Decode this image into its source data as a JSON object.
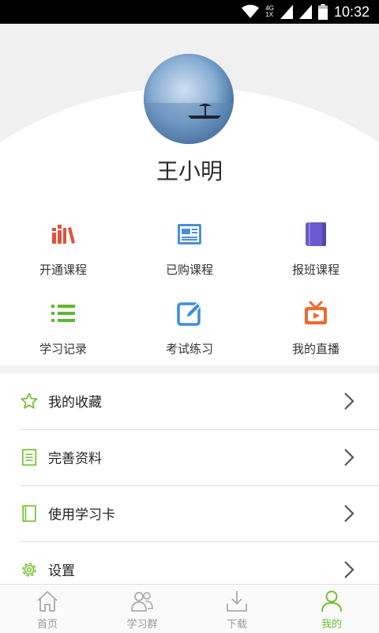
{
  "status_bar": {
    "time": "10:32",
    "net_top": "4G",
    "net_bottom": "1X"
  },
  "profile": {
    "username": "王小明"
  },
  "grid": [
    {
      "label": "开通课程",
      "icon": "books-icon",
      "color": "#e0533b"
    },
    {
      "label": "已购课程",
      "icon": "newspaper-icon",
      "color": "#4a90d9"
    },
    {
      "label": "报班课程",
      "icon": "notebook-icon",
      "color": "#6a5acd"
    },
    {
      "label": "学习记录",
      "icon": "list-icon",
      "color": "#5fb832"
    },
    {
      "label": "考试练习",
      "icon": "edit-icon",
      "color": "#3b8ee0"
    },
    {
      "label": "我的直播",
      "icon": "tv-icon",
      "color": "#f0692c"
    }
  ],
  "menu": [
    {
      "label": "我的收藏",
      "icon": "star-icon"
    },
    {
      "label": "完善资料",
      "icon": "document-icon"
    },
    {
      "label": "使用学习卡",
      "icon": "card-icon"
    },
    {
      "label": "设置",
      "icon": "gear-icon"
    }
  ],
  "tabs": [
    {
      "label": "首页",
      "icon": "home-icon",
      "active": false
    },
    {
      "label": "学习群",
      "icon": "group-icon",
      "active": false
    },
    {
      "label": "下载",
      "icon": "download-icon",
      "active": false
    },
    {
      "label": "我的",
      "icon": "person-icon",
      "active": true
    }
  ],
  "colors": {
    "accent": "#6fbf2c",
    "inactive": "#999999"
  }
}
